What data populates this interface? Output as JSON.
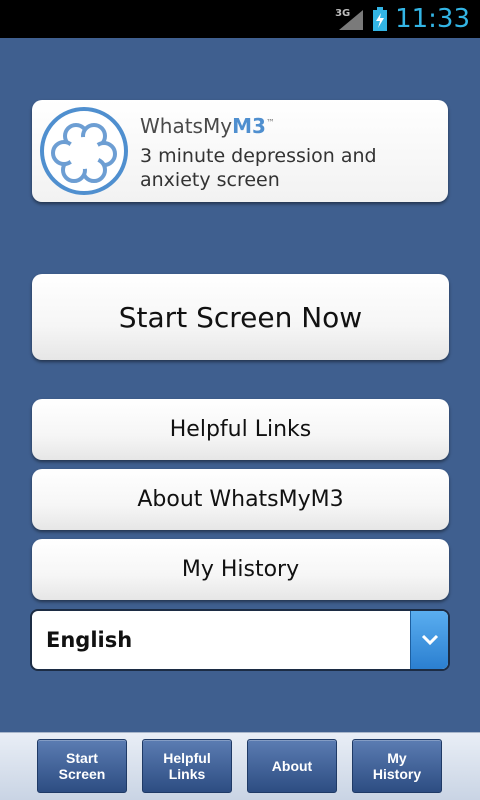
{
  "status_bar": {
    "network": "3G",
    "time": "11:33",
    "icons": [
      "signal-icon",
      "battery-charging-icon"
    ],
    "clock_color": "#33b5e5"
  },
  "logo_card": {
    "brand_prefix": "WhatsMy",
    "brand_suffix": "M3",
    "trademark": "™",
    "tagline": "3 minute depression and anxiety screen",
    "icon": "m3-logo-icon"
  },
  "buttons": {
    "start": "Start Screen Now",
    "links": "Helpful Links",
    "about": "About WhatsMyM3",
    "history": "My History"
  },
  "language_select": {
    "value": "English",
    "icon": "chevron-down-icon"
  },
  "tabs": [
    {
      "label": "Start\nScreen"
    },
    {
      "label": "Helpful\nLinks"
    },
    {
      "label": "About"
    },
    {
      "label": "My\nHistory"
    }
  ],
  "colors": {
    "background": "#3f5f8f",
    "brand_accent": "#4f8fcf",
    "tab_bg": "#3b5b92",
    "dropdown_accent": "#3b8fe0"
  }
}
